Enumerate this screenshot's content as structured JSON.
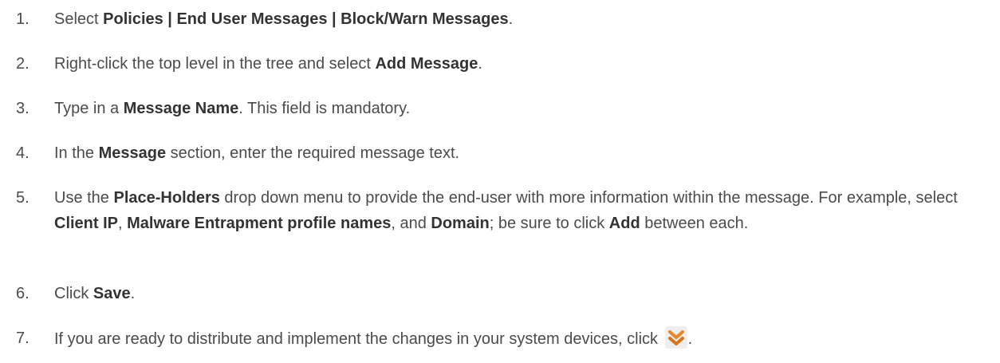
{
  "steps": [
    {
      "number": "1.",
      "parts": [
        {
          "t": "Select ",
          "b": false
        },
        {
          "t": "Policies | End User Messages | Block/Warn Messages",
          "b": true
        },
        {
          "t": ".",
          "b": false
        }
      ]
    },
    {
      "number": "2.",
      "parts": [
        {
          "t": "Right-click the top level in the tree and select ",
          "b": false
        },
        {
          "t": "Add Message",
          "b": true
        },
        {
          "t": ".",
          "b": false
        }
      ]
    },
    {
      "number": "3.",
      "parts": [
        {
          "t": "Type in a ",
          "b": false
        },
        {
          "t": "Message Name",
          "b": true
        },
        {
          "t": ". This field is mandatory.",
          "b": false
        }
      ]
    },
    {
      "number": "4.",
      "parts": [
        {
          "t": "In the ",
          "b": false
        },
        {
          "t": "Message",
          "b": true
        },
        {
          "t": " section, enter the required message text.",
          "b": false
        }
      ]
    },
    {
      "number": "5.",
      "parts": [
        {
          "t": "Use the ",
          "b": false
        },
        {
          "t": "Place-Holders",
          "b": true
        },
        {
          "t": " drop down menu to provide the end-user with more information within the message. For example, select ",
          "b": false
        },
        {
          "t": "Client IP",
          "b": true
        },
        {
          "t": ", ",
          "b": false
        },
        {
          "t": "Malware Entrapment profile names",
          "b": true
        },
        {
          "t": ", and ",
          "b": false
        },
        {
          "t": "Domain",
          "b": true
        },
        {
          "t": "; be sure to click ",
          "b": false
        },
        {
          "t": "Add",
          "b": true
        },
        {
          "t": " between each.",
          "b": false
        }
      ]
    },
    {
      "number": "6.",
      "parts": [
        {
          "t": "Click ",
          "b": false
        },
        {
          "t": "Save",
          "b": true
        },
        {
          "t": ".",
          "b": false
        }
      ]
    },
    {
      "number": "7.",
      "parts": [
        {
          "t": "If you are ready to distribute and implement the changes in your system devices, click ",
          "b": false
        }
      ],
      "icon": "deploy-icon",
      "after_icon": "."
    }
  ],
  "colors": {
    "text": "#4b4b4b",
    "bold_text": "#333333",
    "icon_accent": "#e8862a",
    "icon_bg": "#eeeeee"
  }
}
